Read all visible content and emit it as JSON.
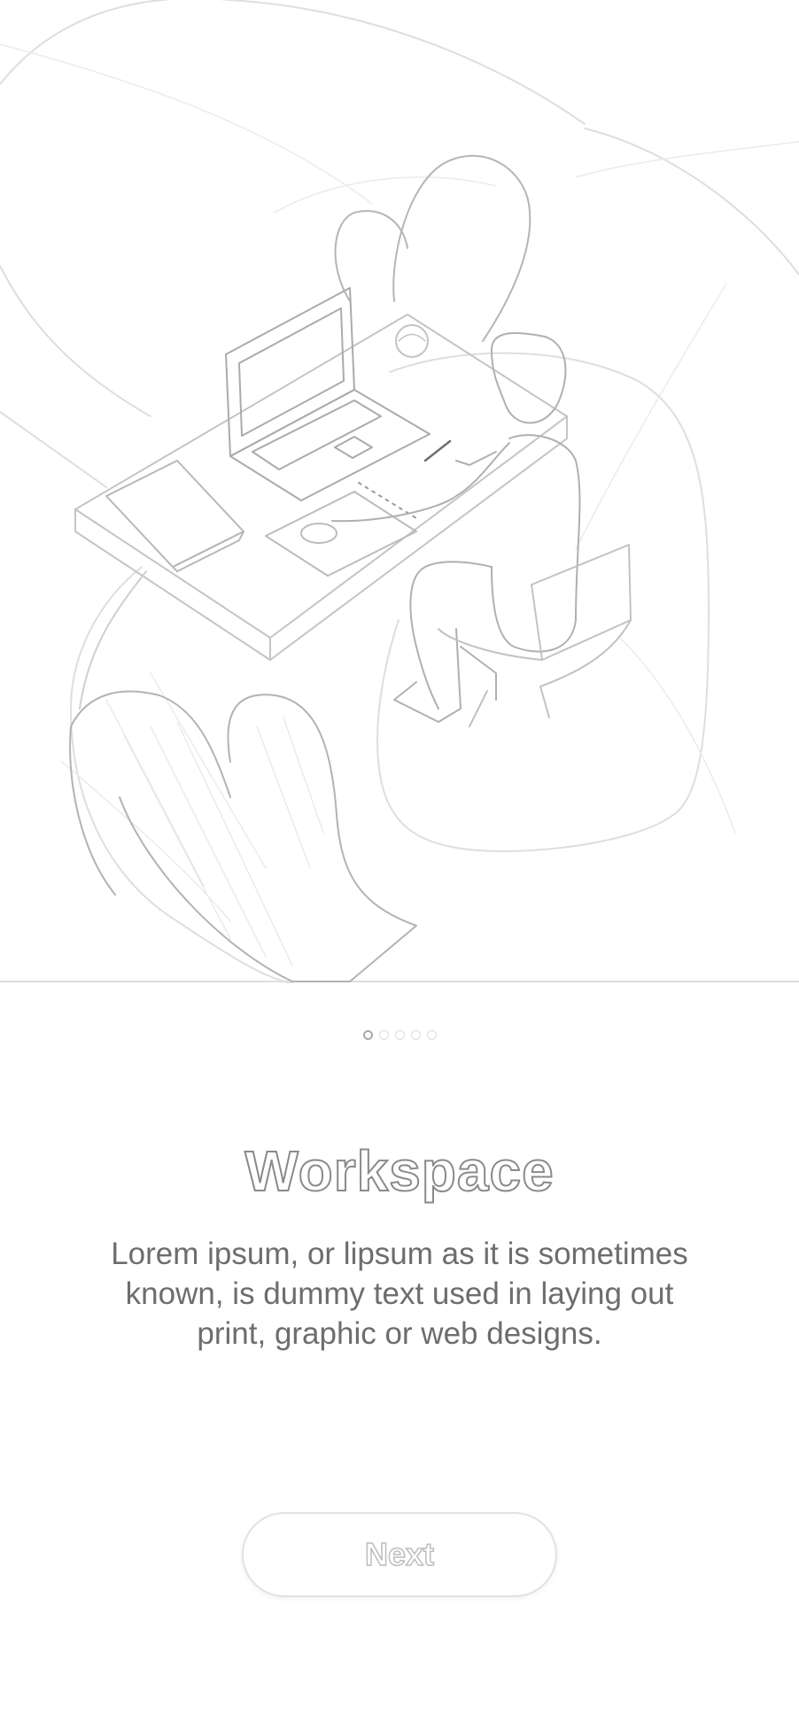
{
  "onboarding": {
    "illustration_icon": "workspace-illustration",
    "page_count": 5,
    "active_page": 1,
    "title": "Workspace",
    "description": "Lorem ipsum, or lipsum as it is sometimes known, is dummy text used in laying out print, graphic or web designs.",
    "next_label": "Next"
  },
  "colors": {
    "background": "#ffffff",
    "line_art": "#bdbdbd",
    "title_outline": "#8a8a8a",
    "body_text": "#6d6d6d",
    "dot_active": "#a9a9a9",
    "dot_inactive": "#dcdcdc",
    "button_border": "#e2e2e2"
  }
}
